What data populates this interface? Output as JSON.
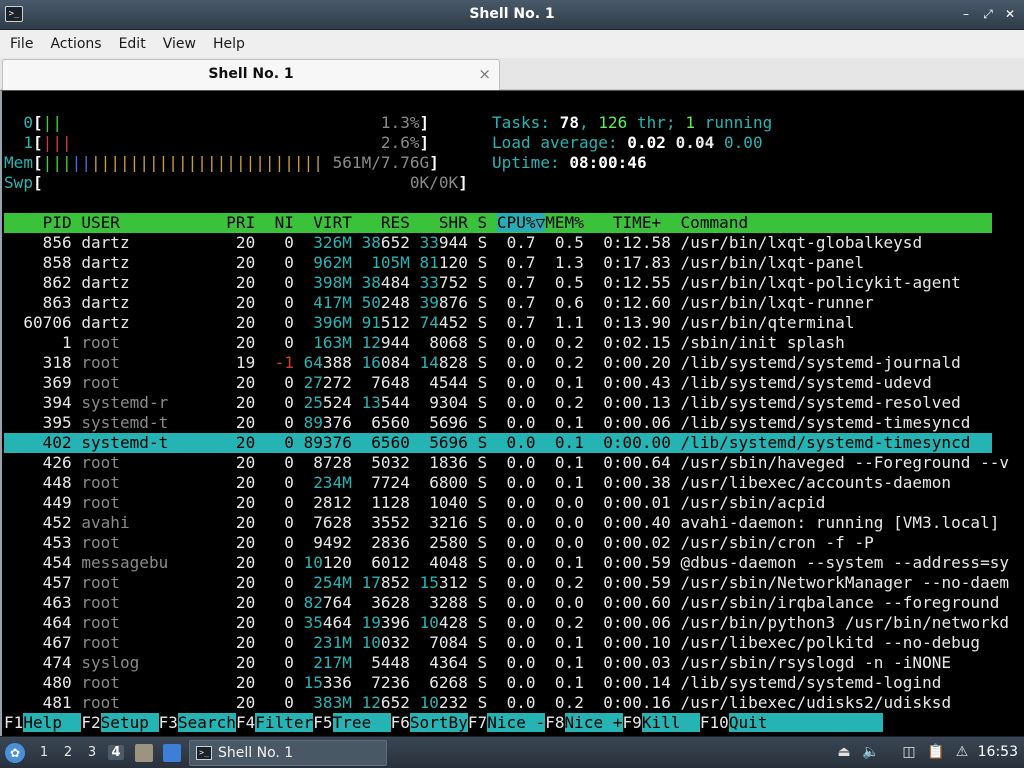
{
  "window": {
    "title": "Shell No. 1",
    "icon": "terminal-icon",
    "controls": [
      "minimize-icon",
      "restore-icon",
      "close-icon"
    ]
  },
  "menu": [
    "File",
    "Actions",
    "Edit",
    "View",
    "Help"
  ],
  "tab": {
    "label": "Shell No. 1",
    "close_glyph": "×"
  },
  "meters": {
    "cpu0": {
      "label": "0",
      "bar_left": "[",
      "bar": "||",
      "value": "1.3%",
      "bar_right": "]"
    },
    "cpu1": {
      "label": "1",
      "bar_left": "[",
      "bar": "|||",
      "value": "2.6%",
      "bar_right": "]"
    },
    "mem": {
      "label": "Mem",
      "bar_left": "[",
      "bar_green": "|||",
      "bar_blue": "||",
      "bar_orange": "||||||||||||||||||||||||",
      "value": "561M/7.76G",
      "bar_right": "]"
    },
    "swp": {
      "label": "Swp",
      "bar_left": "[",
      "value": "0K/0K",
      "bar_right": "]"
    }
  },
  "summary": {
    "tasks_label": "Tasks:",
    "tasks": "78",
    "thr": "126",
    "thr_label": "thr;",
    "running": "1",
    "running_label": "running",
    "load_label": "Load average:",
    "load1": "0.02",
    "load5": "0.04",
    "load15": "0.00",
    "uptime_label": "Uptime:",
    "uptime": "08:00:46"
  },
  "columns": {
    "pid": "PID",
    "user": "USER",
    "pri": "PRI",
    "ni": "NI",
    "virt": "VIRT",
    "res": "RES",
    "shr": "SHR",
    "s": "S",
    "cpu": "CPU%▽",
    "mem": "MEM%",
    "time": "TIME+",
    "command": "Command"
  },
  "processes": [
    {
      "pid": "856",
      "user": "dartz",
      "pri": "20",
      "ni": "0",
      "virt": "326M",
      "res": "38652",
      "shr": "33944",
      "s": "S",
      "cpu": "0.7",
      "mem": "0.5",
      "time": "0:12.58",
      "command": "/usr/bin/lxqt-globalkeysd"
    },
    {
      "pid": "858",
      "user": "dartz",
      "pri": "20",
      "ni": "0",
      "virt": "962M",
      "res": "105M",
      "shr": "81120",
      "s": "S",
      "cpu": "0.7",
      "mem": "1.3",
      "time": "0:17.83",
      "command": "/usr/bin/lxqt-panel"
    },
    {
      "pid": "862",
      "user": "dartz",
      "pri": "20",
      "ni": "0",
      "virt": "398M",
      "res": "38484",
      "shr": "33752",
      "s": "S",
      "cpu": "0.7",
      "mem": "0.5",
      "time": "0:12.55",
      "command": "/usr/bin/lxqt-policykit-agent"
    },
    {
      "pid": "863",
      "user": "dartz",
      "pri": "20",
      "ni": "0",
      "virt": "417M",
      "res": "50248",
      "shr": "39876",
      "s": "S",
      "cpu": "0.7",
      "mem": "0.6",
      "time": "0:12.60",
      "command": "/usr/bin/lxqt-runner"
    },
    {
      "pid": "60706",
      "user": "dartz",
      "pri": "20",
      "ni": "0",
      "virt": "396M",
      "res": "91512",
      "shr": "74452",
      "s": "S",
      "cpu": "0.7",
      "mem": "1.1",
      "time": "0:13.90",
      "command": "/usr/bin/qterminal"
    },
    {
      "pid": "1",
      "user": "root",
      "pri": "20",
      "ni": "0",
      "virt": "163M",
      "res": "12944",
      "shr": "8068",
      "s": "S",
      "cpu": "0.0",
      "mem": "0.2",
      "time": "0:02.15",
      "command": "/sbin/init splash"
    },
    {
      "pid": "318",
      "user": "root",
      "pri": "19",
      "ni": "-1",
      "virt": "64388",
      "res": "16084",
      "shr": "14828",
      "s": "S",
      "cpu": "0.0",
      "mem": "0.2",
      "time": "0:00.20",
      "command": "/lib/systemd/systemd-journald"
    },
    {
      "pid": "369",
      "user": "root",
      "pri": "20",
      "ni": "0",
      "virt": "27272",
      "res": "7648",
      "shr": "4544",
      "s": "S",
      "cpu": "0.0",
      "mem": "0.1",
      "time": "0:00.43",
      "command": "/lib/systemd/systemd-udevd"
    },
    {
      "pid": "394",
      "user": "systemd-r",
      "pri": "20",
      "ni": "0",
      "virt": "25524",
      "res": "13544",
      "shr": "9304",
      "s": "S",
      "cpu": "0.0",
      "mem": "0.2",
      "time": "0:00.13",
      "command": "/lib/systemd/systemd-resolved"
    },
    {
      "pid": "395",
      "user": "systemd-t",
      "pri": "20",
      "ni": "0",
      "virt": "89376",
      "res": "6560",
      "shr": "5696",
      "s": "S",
      "cpu": "0.0",
      "mem": "0.1",
      "time": "0:00.06",
      "command": "/lib/systemd/systemd-timesyncd"
    },
    {
      "pid": "402",
      "user": "systemd-t",
      "pri": "20",
      "ni": "0",
      "virt": "89376",
      "res": "6560",
      "shr": "5696",
      "s": "S",
      "cpu": "0.0",
      "mem": "0.1",
      "time": "0:00.00",
      "command": "/lib/systemd/systemd-timesyncd",
      "selected": true
    },
    {
      "pid": "426",
      "user": "root",
      "pri": "20",
      "ni": "0",
      "virt": "8728",
      "res": "5032",
      "shr": "1836",
      "s": "S",
      "cpu": "0.0",
      "mem": "0.1",
      "time": "0:00.64",
      "command": "/usr/sbin/haveged --Foreground --v"
    },
    {
      "pid": "448",
      "user": "root",
      "pri": "20",
      "ni": "0",
      "virt": "234M",
      "res": "7724",
      "shr": "6800",
      "s": "S",
      "cpu": "0.0",
      "mem": "0.1",
      "time": "0:00.38",
      "command": "/usr/libexec/accounts-daemon"
    },
    {
      "pid": "449",
      "user": "root",
      "pri": "20",
      "ni": "0",
      "virt": "2812",
      "res": "1128",
      "shr": "1040",
      "s": "S",
      "cpu": "0.0",
      "mem": "0.0",
      "time": "0:00.01",
      "command": "/usr/sbin/acpid"
    },
    {
      "pid": "452",
      "user": "avahi",
      "pri": "20",
      "ni": "0",
      "virt": "7628",
      "res": "3552",
      "shr": "3216",
      "s": "S",
      "cpu": "0.0",
      "mem": "0.0",
      "time": "0:00.40",
      "command": "avahi-daemon: running [VM3.local]"
    },
    {
      "pid": "453",
      "user": "root",
      "pri": "20",
      "ni": "0",
      "virt": "9492",
      "res": "2836",
      "shr": "2580",
      "s": "S",
      "cpu": "0.0",
      "mem": "0.0",
      "time": "0:00.02",
      "command": "/usr/sbin/cron -f -P"
    },
    {
      "pid": "454",
      "user": "messagebu",
      "pri": "20",
      "ni": "0",
      "virt": "10120",
      "res": "6012",
      "shr": "4048",
      "s": "S",
      "cpu": "0.0",
      "mem": "0.1",
      "time": "0:00.59",
      "command": "@dbus-daemon --system --address=sy"
    },
    {
      "pid": "457",
      "user": "root",
      "pri": "20",
      "ni": "0",
      "virt": "254M",
      "res": "17852",
      "shr": "15312",
      "s": "S",
      "cpu": "0.0",
      "mem": "0.2",
      "time": "0:00.59",
      "command": "/usr/sbin/NetworkManager --no-daem"
    },
    {
      "pid": "463",
      "user": "root",
      "pri": "20",
      "ni": "0",
      "virt": "82764",
      "res": "3628",
      "shr": "3288",
      "s": "S",
      "cpu": "0.0",
      "mem": "0.0",
      "time": "0:00.60",
      "command": "/usr/sbin/irqbalance --foreground"
    },
    {
      "pid": "464",
      "user": "root",
      "pri": "20",
      "ni": "0",
      "virt": "35464",
      "res": "19396",
      "shr": "10428",
      "s": "S",
      "cpu": "0.0",
      "mem": "0.2",
      "time": "0:00.06",
      "command": "/usr/bin/python3 /usr/bin/networkd"
    },
    {
      "pid": "467",
      "user": "root",
      "pri": "20",
      "ni": "0",
      "virt": "231M",
      "res": "10032",
      "shr": "7084",
      "s": "S",
      "cpu": "0.0",
      "mem": "0.1",
      "time": "0:00.10",
      "command": "/usr/libexec/polkitd --no-debug"
    },
    {
      "pid": "474",
      "user": "syslog",
      "pri": "20",
      "ni": "0",
      "virt": "217M",
      "res": "5448",
      "shr": "4364",
      "s": "S",
      "cpu": "0.0",
      "mem": "0.1",
      "time": "0:00.03",
      "command": "/usr/sbin/rsyslogd -n -iNONE"
    },
    {
      "pid": "480",
      "user": "root",
      "pri": "20",
      "ni": "0",
      "virt": "15336",
      "res": "7236",
      "shr": "6268",
      "s": "S",
      "cpu": "0.0",
      "mem": "0.1",
      "time": "0:00.14",
      "command": "/lib/systemd/systemd-logind"
    },
    {
      "pid": "481",
      "user": "root",
      "pri": "20",
      "ni": "0",
      "virt": "383M",
      "res": "12652",
      "shr": "10232",
      "s": "S",
      "cpu": "0.0",
      "mem": "0.2",
      "time": "0:00.16",
      "command": "/usr/libexec/udisks2/udisksd"
    }
  ],
  "function_keys": [
    {
      "key": "F1",
      "label": "Help  "
    },
    {
      "key": "F2",
      "label": "Setup "
    },
    {
      "key": "F3",
      "label": "Search"
    },
    {
      "key": "F4",
      "label": "Filter"
    },
    {
      "key": "F5",
      "label": "Tree  "
    },
    {
      "key": "F6",
      "label": "SortBy"
    },
    {
      "key": "F7",
      "label": "Nice -"
    },
    {
      "key": "F8",
      "label": "Nice +"
    },
    {
      "key": "F9",
      "label": "Kill  "
    },
    {
      "key": "F10",
      "label": "Quit  "
    }
  ],
  "taskbar": {
    "start_icon": "lxqt-start-icon",
    "desktops": [
      "1",
      "2",
      "3",
      "4"
    ],
    "active_desktop": "4",
    "launchers": [
      "file-manager-icon",
      "show-desktop-icon"
    ],
    "task_label": "Shell No. 1",
    "task_icon": "terminal-icon",
    "tray": [
      "eject-icon",
      "volume-icon",
      "network-icon",
      "clipboard-icon",
      "update-notifier-icon"
    ],
    "clock": "16:53"
  },
  "colors": {
    "header_bar": "#3ac23a",
    "selection": "#26b3b3",
    "panel": "#2f3b47"
  }
}
